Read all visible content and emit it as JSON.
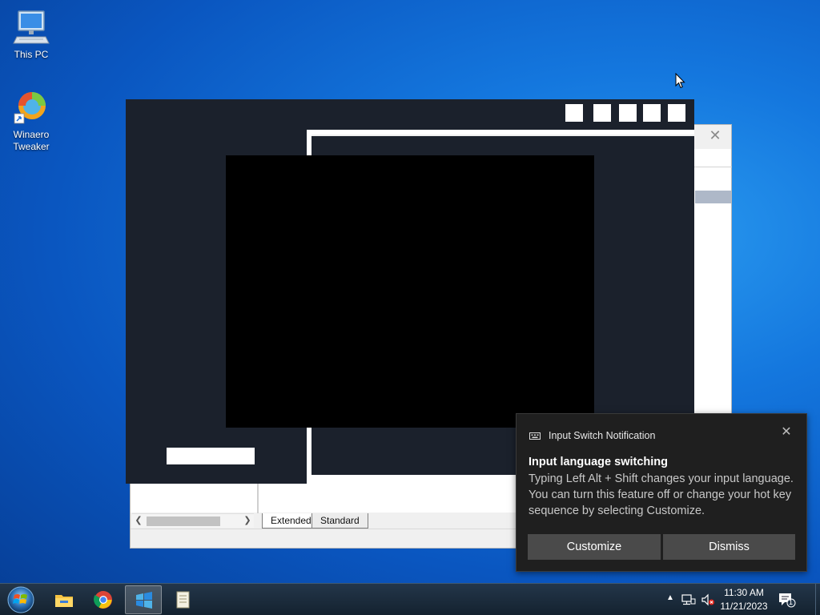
{
  "desktop": {
    "icons": [
      {
        "label": "This PC",
        "icon": "computer-icon"
      },
      {
        "label": "Winaero\nTweaker",
        "icon": "winaero-tweaker-icon"
      }
    ]
  },
  "background_window": {
    "close_glyph": "✕",
    "sheet_tabs": [
      "Extended",
      "Standard"
    ]
  },
  "notification": {
    "app_name": "Input Switch Notification",
    "app_icon": "keyboard-icon",
    "title": "Input language switching",
    "body": "Typing Left Alt + Shift changes your input language. You can turn this feature off or change your hot key sequence by selecting Customize.",
    "buttons": {
      "customize": "Customize",
      "dismiss": "Dismiss"
    },
    "close_glyph": "✕"
  },
  "taskbar": {
    "apps": [
      {
        "name": "file-explorer-icon"
      },
      {
        "name": "chrome-icon"
      },
      {
        "name": "winaero-tweaker-icon",
        "active": true
      },
      {
        "name": "notepad-icon"
      }
    ],
    "clock": {
      "time": "11:30 AM",
      "date": "11/21/2023"
    },
    "action_center_badge": "1",
    "tray_icons": [
      "chevron-up-icon",
      "network-icon",
      "volume-muted-icon"
    ]
  },
  "colors": {
    "dark_window": "#1b212c",
    "toast_bg": "#1f1f1f",
    "toast_button": "#4a4a4a"
  }
}
